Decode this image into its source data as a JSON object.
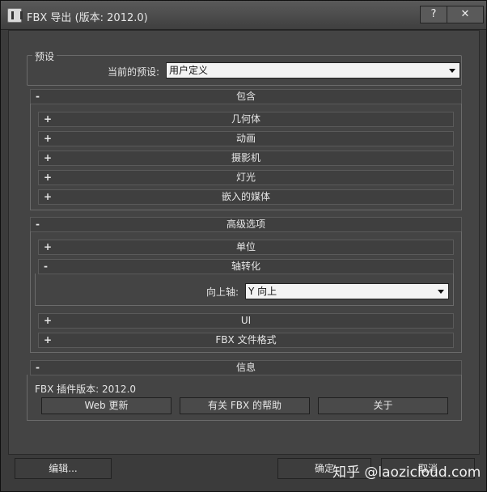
{
  "window": {
    "title": "FBX 导出 (版本: 2012.0)",
    "help_label": "?",
    "close_label": "✕"
  },
  "presets": {
    "group_label": "预设",
    "current_label": "当前的预设:",
    "current_value": "用户定义"
  },
  "include": {
    "sign": "-",
    "label": "包含",
    "items": [
      {
        "sign": "+",
        "label": "几何体"
      },
      {
        "sign": "+",
        "label": "动画"
      },
      {
        "sign": "+",
        "label": "摄影机"
      },
      {
        "sign": "+",
        "label": "灯光"
      },
      {
        "sign": "+",
        "label": "嵌入的媒体"
      }
    ]
  },
  "advanced": {
    "sign": "-",
    "label": "高级选项",
    "units": {
      "sign": "+",
      "label": "单位"
    },
    "axis": {
      "sign": "-",
      "label": "轴转化",
      "up_axis_label": "向上轴:",
      "up_axis_value": "Y 向上"
    },
    "ui": {
      "sign": "+",
      "label": "UI"
    },
    "fbx_format": {
      "sign": "+",
      "label": "FBX 文件格式"
    }
  },
  "info": {
    "sign": "-",
    "label": "信息",
    "plugin_version": "FBX 插件版本: 2012.0",
    "web_update": "Web 更新",
    "help_about_fbx": "有关 FBX 的帮助",
    "about": "关于"
  },
  "footer": {
    "edit_label": "编辑...",
    "ok_label": "确定",
    "cancel_label": "取消"
  },
  "watermark": "知乎 @laozicloud.com"
}
